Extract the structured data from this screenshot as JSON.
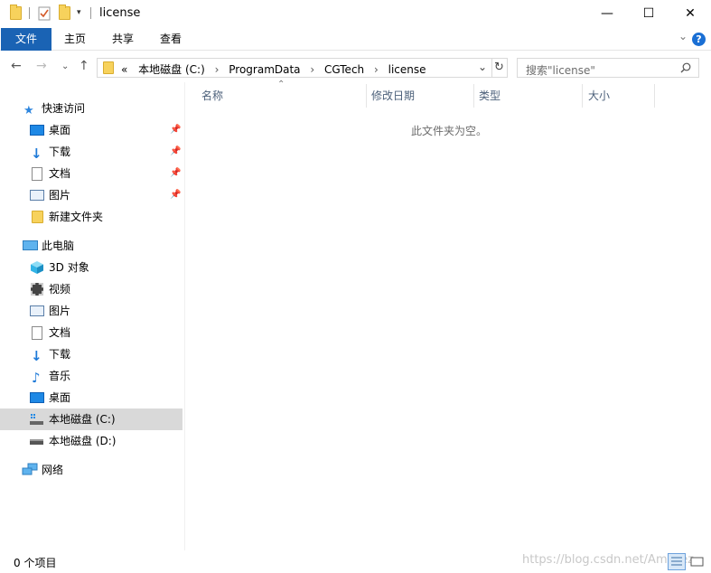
{
  "window": {
    "title": "license",
    "minimize_icon": "minimize-icon",
    "maximize_icon": "maximize-icon",
    "close_icon": "close-icon"
  },
  "ribbon": {
    "tabs": [
      "文件",
      "主页",
      "共享",
      "查看"
    ],
    "accent": "#1a63b4"
  },
  "address": {
    "collapse_glyph": "«",
    "crumbs": [
      "本地磁盘 (C:)",
      "ProgramData",
      "CGTech",
      "license"
    ]
  },
  "search": {
    "placeholder": "搜索\"license\""
  },
  "sidebar": {
    "quick_access": {
      "label": "快速访问",
      "items": [
        {
          "label": "桌面",
          "icon": "desktop-icon",
          "pinned": true
        },
        {
          "label": "下载",
          "icon": "download-icon",
          "pinned": true
        },
        {
          "label": "文档",
          "icon": "documents-icon",
          "pinned": true
        },
        {
          "label": "图片",
          "icon": "pictures-icon",
          "pinned": true
        },
        {
          "label": "新建文件夹",
          "icon": "folder-icon",
          "pinned": false
        }
      ]
    },
    "this_pc": {
      "label": "此电脑",
      "items": [
        {
          "label": "3D 对象",
          "icon": "3d-objects-icon"
        },
        {
          "label": "视频",
          "icon": "videos-icon"
        },
        {
          "label": "图片",
          "icon": "pictures-icon"
        },
        {
          "label": "文档",
          "icon": "documents-icon"
        },
        {
          "label": "下载",
          "icon": "download-icon"
        },
        {
          "label": "音乐",
          "icon": "music-icon"
        },
        {
          "label": "桌面",
          "icon": "desktop-icon"
        },
        {
          "label": "本地磁盘 (C:)",
          "icon": "drive-c-icon",
          "selected": true
        },
        {
          "label": "本地磁盘 (D:)",
          "icon": "drive-d-icon"
        }
      ]
    },
    "network": {
      "label": "网络"
    }
  },
  "columns": [
    "名称",
    "修改日期",
    "类型",
    "大小"
  ],
  "empty_message": "此文件夹为空。",
  "status": {
    "count": "0 个项目"
  },
  "watermark": "https://blog.csdn.net/Ama_ez"
}
